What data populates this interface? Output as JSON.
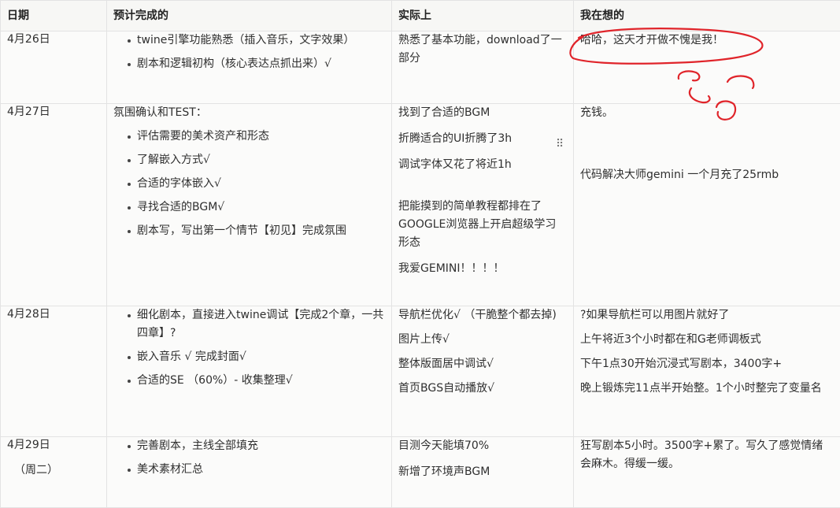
{
  "headers": {
    "date": "日期",
    "plan": "预计完成的",
    "actual": "实际上",
    "thinking": "我在想的"
  },
  "rows": [
    {
      "date": "4月26日",
      "plan_items": [
        "twine引擎功能熟悉（插入音乐，文字效果）",
        "剧本和逻辑初构（核心表达点抓出来）√"
      ],
      "actual": [
        "熟悉了基本功能，download了一部分"
      ],
      "thinking": [
        "哈哈，这天才开做不愧是我！"
      ]
    },
    {
      "date": "4月27日",
      "plan_lead": "氛围确认和TEST：",
      "plan_items": [
        "评估需要的美术资产和形态",
        "了解嵌入方式√",
        "合适的字体嵌入√",
        "寻找合适的BGM√",
        "剧本写，写出第一个情节【初见】完成氛围"
      ],
      "actual": [
        "找到了合适的BGM",
        "折腾适合的UI折腾了3h",
        "调试字体又花了将近1h",
        "把能摸到的简单教程都排在了GOOGLE浏览器上开启超级学习形态",
        "我爱GEMINI！！！！"
      ],
      "thinking": [
        "充钱。",
        "代码解决大师gemini 一个月充了25rmb"
      ]
    },
    {
      "date": "4月28日",
      "plan_items": [
        "细化剧本，直接进入twine调试【完成2个章，一共四章】?",
        "嵌入音乐 √ 完成封面√",
        "合适的SE （60%）- 收集整理√"
      ],
      "actual": [
        "导航栏优化√ （干脆整个都去掉)",
        "图片上传√",
        "整体版面居中调试√",
        "首页BGS自动播放√"
      ],
      "thinking": [
        "?如果导航栏可以用图片就好了",
        "上午将近3个小时都在和G老师调板式",
        "下午1点30开始沉浸式写剧本，3400字+",
        "晚上锻炼完11点半开始整。1个小时整完了变量名"
      ]
    },
    {
      "date": "4月29日",
      "date_sub": "（周二）",
      "plan_items": [
        "完善剧本，主线全部填充",
        "美术素材汇总"
      ],
      "actual": [
        "目测今天能填70%",
        "新增了环境声BGM"
      ],
      "thinking": [
        "狂写剧本5小时。3500字+累了。写久了感觉情绪会麻木。得缓一缓。"
      ]
    }
  ],
  "drag_handle_glyph": "⠿",
  "ink_color": "#e0242a"
}
